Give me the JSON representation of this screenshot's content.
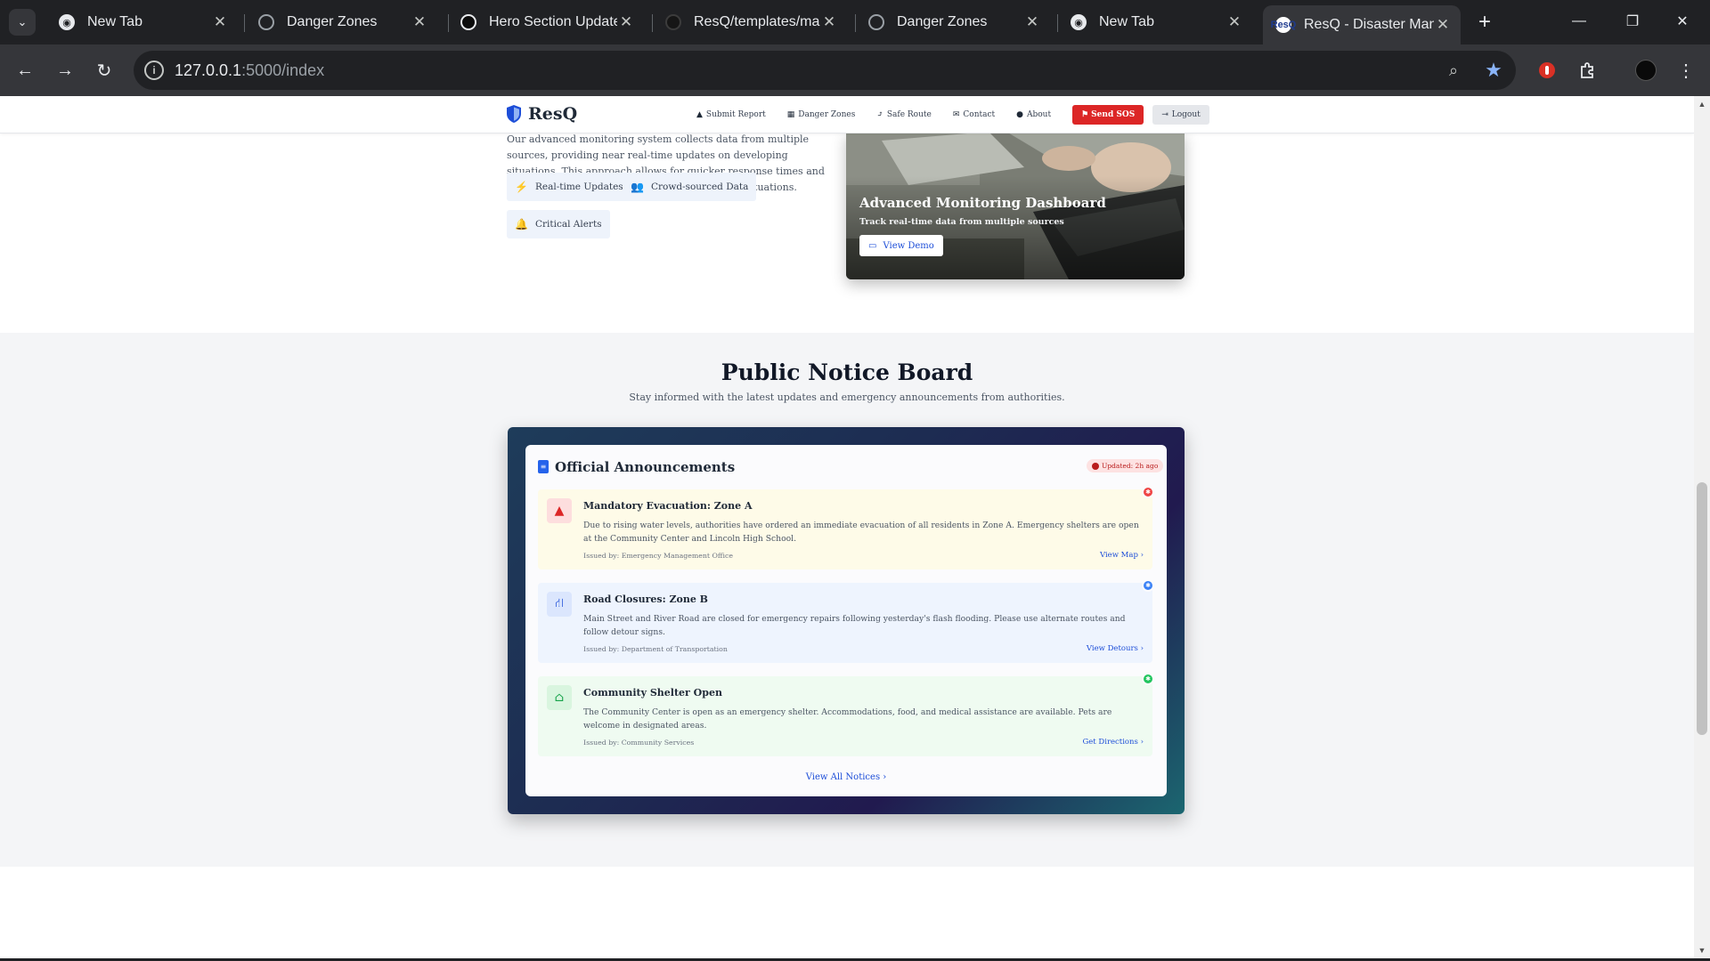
{
  "browser": {
    "tabs": [
      {
        "title": "New Tab",
        "favicon": "chrome-icon"
      },
      {
        "title": "Danger Zones",
        "favicon": "globe-icon"
      },
      {
        "title": "Hero Section Update",
        "favicon": "openai-icon"
      },
      {
        "title": "ResQ/templates/map",
        "favicon": "github-icon"
      },
      {
        "title": "Danger Zones",
        "favicon": "globe-icon"
      },
      {
        "title": "New Tab",
        "favicon": "chrome-icon"
      },
      {
        "title": "ResQ - Disaster Mana",
        "favicon": "resq-favicon",
        "active": true
      }
    ],
    "address": {
      "host": "127.0.0.1",
      "path": ":5000/index"
    },
    "colors": {
      "chrome_dark": "#202124",
      "chrome_toolbar": "#35363a",
      "bookmark_star": "#8ab4f8"
    }
  },
  "site": {
    "brand": "ResQ",
    "nav": {
      "submit_report": "Submit Report",
      "danger_zones": "Danger Zones",
      "safe_route": "Safe Route",
      "contact": "Contact",
      "about": "About",
      "send_sos": "Send SOS",
      "logout": "Logout"
    },
    "colors": {
      "primary": "#1d4ed8",
      "sos": "#dc2626"
    }
  },
  "monitoring": {
    "paragraph": "Our advanced monitoring system collects data from multiple sources, providing near real-time updates on developing situations. This approach allows for quicker response times and more effective resource allocation during crisis situations.",
    "chips": [
      "Real-time Updates",
      "Crowd-sourced Data",
      "Critical Alerts"
    ],
    "card": {
      "title": "Advanced Monitoring Dashboard",
      "subtitle": "Track real-time data from multiple sources",
      "button": "View Demo"
    }
  },
  "notice_board": {
    "title": "Public Notice Board",
    "subtitle": "Stay informed with the latest updates and emergency announcements from authorities.",
    "panel_title": "Official Announcements",
    "updated": "Updated: 2h ago",
    "notices": [
      {
        "title": "Mandatory Evacuation: Zone A",
        "body": "Due to rising water levels, authorities have ordered an immediate evacuation of all residents in Zone A. Emergency shelters are open at the Community Center and Lincoln High School.",
        "issued": "Issued by: Emergency Management Office",
        "link": "View Map",
        "color": "#fefbe8"
      },
      {
        "title": "Road Closures: Zone B",
        "body": "Main Street and River Road are closed for emergency repairs following yesterday's flash flooding. Please use alternate routes and follow detour signs.",
        "issued": "Issued by: Department of Transportation",
        "link": "View Detours",
        "color": "#eef4fe"
      },
      {
        "title": "Community Shelter Open",
        "body": "The Community Center is open as an emergency shelter. Accommodations, food, and medical assistance are available. Pets are welcome in designated areas.",
        "issued": "Issued by: Community Services",
        "link": "Get Directions",
        "color": "#effbf1"
      }
    ],
    "view_all": "View All Notices"
  }
}
